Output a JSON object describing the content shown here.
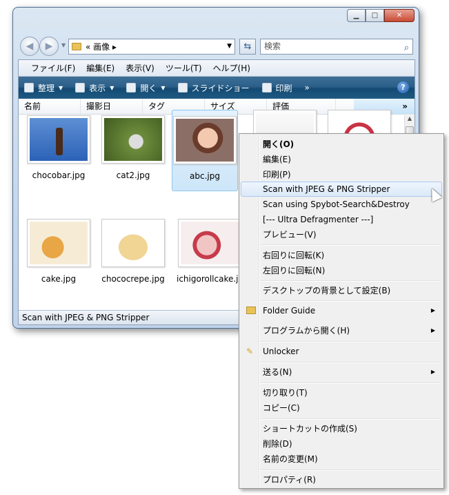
{
  "window": {
    "address": "« 画像 ▸",
    "search_placeholder": "検索"
  },
  "menubar": [
    "ファイル(F)",
    "編集(E)",
    "表示(V)",
    "ツール(T)",
    "ヘルプ(H)"
  ],
  "toolbar": {
    "organize": "整理",
    "view": "表示",
    "open": "開く",
    "slideshow": "スライドショー",
    "print": "印刷",
    "more": "»"
  },
  "columns": [
    "名前",
    "撮影日",
    "タグ",
    "サイズ",
    "評価"
  ],
  "columns_more": "»",
  "files": [
    {
      "name": "chocobar.jpg"
    },
    {
      "name": "cat2.jpg"
    },
    {
      "name": "abc.jpg"
    },
    {
      "name": "cake.jpg"
    },
    {
      "name": "chococrepe.jpg"
    },
    {
      "name": "ichigorollcake.jpg"
    }
  ],
  "status": "Scan with JPEG & PNG Stripper",
  "context_menu": {
    "items": [
      {
        "label": "開く(O)"
      },
      {
        "label": "編集(E)"
      },
      {
        "label": "印刷(P)"
      },
      {
        "label": "Scan with JPEG & PNG Stripper"
      },
      {
        "label": "Scan using Spybot-Search&Destroy"
      },
      {
        "label": "[--- Ultra Defragmenter ---]"
      },
      {
        "label": "プレビュー(V)"
      },
      {
        "label": "右回りに回転(K)"
      },
      {
        "label": "左回りに回転(N)"
      },
      {
        "label": "デスクトップの背景として設定(B)"
      },
      {
        "label": "Folder Guide"
      },
      {
        "label": "プログラムから開く(H)"
      },
      {
        "label": "Unlocker"
      },
      {
        "label": "送る(N)"
      },
      {
        "label": "切り取り(T)"
      },
      {
        "label": "コピー(C)"
      },
      {
        "label": "ショートカットの作成(S)"
      },
      {
        "label": "削除(D)"
      },
      {
        "label": "名前の変更(M)"
      },
      {
        "label": "プロパティ(R)"
      }
    ]
  }
}
